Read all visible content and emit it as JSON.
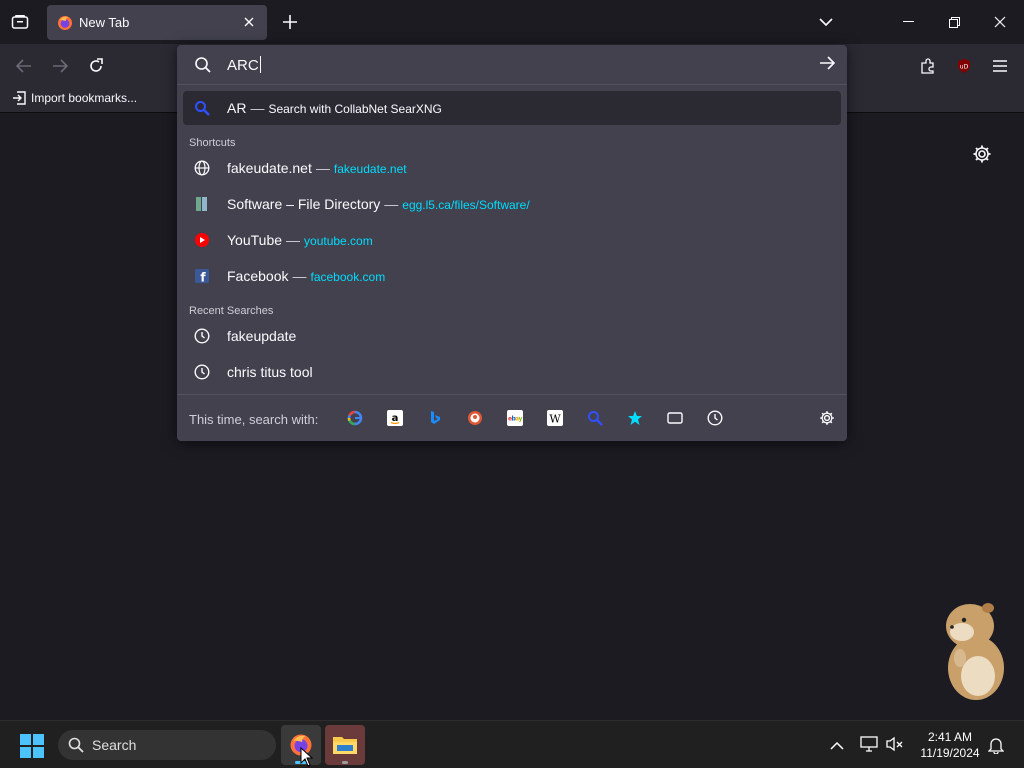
{
  "window": {
    "tab_title": "New Tab"
  },
  "bookmarks_bar": {
    "import_label": "Import bookmarks..."
  },
  "urlbar": {
    "input_value": "ARC",
    "heuristic": {
      "query": "AR",
      "separator": "—",
      "action": "Search with CollabNet SearXNG"
    },
    "shortcuts_label": "Shortcuts",
    "shortcuts": [
      {
        "title": "fakeudate.net",
        "url": "fakeudate.net",
        "icon": "globe-icon"
      },
      {
        "title": "Software – File Directory",
        "url": "egg.l5.ca/files/Software/",
        "icon": "folder-icon"
      },
      {
        "title": "YouTube",
        "url": "youtube.com",
        "icon": "youtube-icon"
      },
      {
        "title": "Facebook",
        "url": "facebook.com",
        "icon": "facebook-icon"
      }
    ],
    "recent_label": "Recent Searches",
    "recent": [
      {
        "title": "fakeupdate",
        "icon": "history-icon"
      },
      {
        "title": "chris titus tool",
        "icon": "history-icon"
      }
    ],
    "oneoff_label": "This time, search with:",
    "engines": [
      "google-icon",
      "amazon-icon",
      "bing-icon",
      "duckduckgo-icon",
      "ebay-icon",
      "wikipedia-icon",
      "searxng-icon",
      "bookmarks-icon",
      "tabs-icon",
      "history-icon"
    ]
  },
  "taskbar": {
    "search_label": "Search",
    "time": "2:41 AM",
    "date": "11/19/2024"
  },
  "colors": {
    "accent_url": "#00ddff",
    "popup_bg": "#42414d",
    "toolbar_bg": "#2b2a33",
    "page_bg": "#1c1b22"
  }
}
